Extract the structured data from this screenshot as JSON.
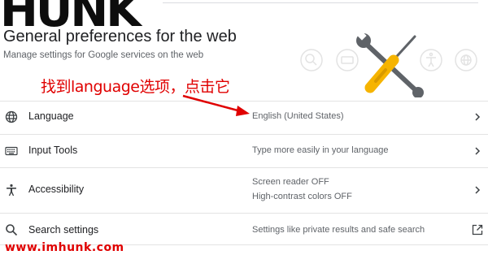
{
  "logo": {
    "text": "HUNK"
  },
  "header": {
    "title": "General preferences for the web",
    "subtitle": "Manage settings for Google services on the web"
  },
  "annotation": {
    "text": "找到language选项，点击它"
  },
  "rows": [
    {
      "label": "Language",
      "desc1": "English (United States)",
      "desc2": "",
      "icon": "globe-icon",
      "action": "chevron-right-icon"
    },
    {
      "label": "Input Tools",
      "desc1": "Type more easily in your language",
      "desc2": "",
      "icon": "keyboard-icon",
      "action": "chevron-right-icon"
    },
    {
      "label": "Accessibility",
      "desc1": "Screen reader OFF",
      "desc2": "High-contrast colors OFF",
      "icon": "accessibility-icon",
      "action": "chevron-right-icon"
    },
    {
      "label": "Search settings",
      "desc1": "Settings like private results and safe search",
      "desc2": "",
      "icon": "search-icon",
      "action": "open-in-new-icon"
    }
  ],
  "watermark": {
    "text": "www.imhunk.com"
  },
  "colors": {
    "annotation": "#e00000",
    "tool_handle": "#f6b400",
    "tool_metal": "#5f6368"
  }
}
